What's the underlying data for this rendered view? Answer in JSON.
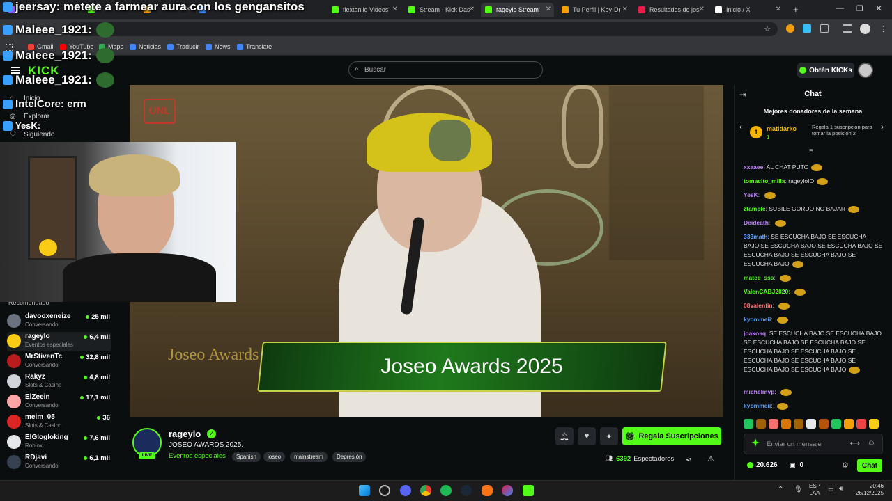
{
  "browser": {
    "tabs": [
      {
        "label": "",
        "color": "#8b5cf6"
      },
      {
        "label": "",
        "color": "#53fc18"
      },
      {
        "label": "",
        "color": "#f59e0b"
      },
      {
        "label": "",
        "color": "#3b82f6"
      },
      {
        "label": "flextanilo Videos",
        "color": "#53fc18"
      },
      {
        "label": "Stream - Kick Das",
        "color": "#53fc18"
      },
      {
        "label": "rageylo Stream",
        "color": "#53fc18",
        "active": true
      },
      {
        "label": "Tu Perfil | Key-Dr",
        "color": "#f59e0b"
      },
      {
        "label": "Resultados de jos",
        "color": "#e11d48"
      },
      {
        "label": "Inicio / X",
        "color": "#ffffff"
      }
    ],
    "bookmarks": [
      {
        "label": "Gmail",
        "color": "#ea4335"
      },
      {
        "label": "YouTube",
        "color": "#ff0000"
      },
      {
        "label": "Maps",
        "color": "#34a853"
      },
      {
        "label": "Noticias",
        "color": "#4285f4"
      },
      {
        "label": "Traducir",
        "color": "#4285f4"
      },
      {
        "label": "News",
        "color": "#4285f4"
      },
      {
        "label": "Translate",
        "color": "#4285f4"
      }
    ]
  },
  "overlay_chat": [
    {
      "text": "jeersay: metete a farmear aura con los gengansitos"
    },
    {
      "text": "Maleee_1921:"
    },
    {
      "text": "Maleee_1921:"
    },
    {
      "text": "Maleee_1921:"
    },
    {
      "text": "IntelCore: erm"
    },
    {
      "text": "YesK:"
    }
  ],
  "header": {
    "logo": "KICK",
    "search_placeholder": "Buscar",
    "obten_label": "Obtén KICKs"
  },
  "sidebar": {
    "nav": [
      {
        "label": "Inicio",
        "icon": "home-icon"
      },
      {
        "label": "Explorar",
        "icon": "compass-icon"
      },
      {
        "label": "Siguiendo",
        "icon": "heart-icon"
      }
    ],
    "section_title": "Recomendado",
    "recommended": [
      {
        "name": "davooxeneize",
        "category": "Conversando",
        "viewers": "25 mil",
        "color": "#6b7280"
      },
      {
        "name": "rageylo",
        "category": "Eventos especiales",
        "viewers": "6,4 mil",
        "color": "#facc15",
        "active": true
      },
      {
        "name": "MrStivenTc",
        "category": "Conversando",
        "viewers": "32,8 mil",
        "color": "#b91c1c"
      },
      {
        "name": "Rakyz",
        "category": "Slots & Casino",
        "viewers": "4,8 mil",
        "color": "#d1d5db"
      },
      {
        "name": "ElZeein",
        "category": "Conversando",
        "viewers": "17,1 mil",
        "color": "#fca5a5"
      },
      {
        "name": "meim_05",
        "category": "Slots & Casino",
        "viewers": "36",
        "color": "#dc2626"
      },
      {
        "name": "ElGlogloking",
        "category": "Roblox",
        "viewers": "7,6 mil",
        "color": "#e5e7eb"
      },
      {
        "name": "RDjavi",
        "category": "Conversando",
        "viewers": "6,1 mil",
        "color": "#374151"
      }
    ]
  },
  "player": {
    "banner_text": "Joseo Awards 2025",
    "logo_text": "UNL",
    "watermark": "Joseo Awards"
  },
  "stream": {
    "channel": "rageylo",
    "live_label": "LIVE",
    "title": "JOSEO AWARDS 2025.",
    "category": "Eventos especiales",
    "tags": [
      "Spanish",
      "joseo",
      "mainstream",
      "Depresión"
    ],
    "subscribe_label": "Regala Suscripciones",
    "viewers_count": "6392",
    "viewers_label": "Espectadores"
  },
  "chat": {
    "title": "Chat",
    "donors_title": "Mejores donadores de la semana",
    "donor_name": "matidarko",
    "donor_count": "1",
    "donor_promo": "Regala 1 suscripción para tomar la posición 2",
    "messages": [
      {
        "user": "xxaaee",
        "color": "#c084fc",
        "text": "AL CHAT PUTO"
      },
      {
        "user": "tomacito_milla",
        "color": "#53fc18",
        "text": "rageyloIO"
      },
      {
        "user": "YesK",
        "color": "#c084fc",
        "text": ""
      },
      {
        "user": "ztample",
        "color": "#53fc18",
        "text": "SUBILE GORDO NO BAJAR"
      },
      {
        "user": "Deideath",
        "color": "#c084fc",
        "text": ""
      },
      {
        "user": "333math",
        "color": "#60a5fa",
        "text": "SE ESCUCHA BAJO SE ESCUCHA BAJO SE ESCUCHA BAJO SE ESCUCHA BAJO SE ESCUCHA BAJO SE ESCUCHA BAJO SE ESCUCHA BAJO"
      },
      {
        "user": "matee_sss",
        "color": "#53fc18",
        "text": ""
      },
      {
        "user": "ValenCABJ2020",
        "color": "#53fc18",
        "text": ""
      },
      {
        "user": "08valentin",
        "color": "#f87171",
        "text": ""
      },
      {
        "user": "kyommeii",
        "color": "#60a5fa",
        "text": ""
      },
      {
        "user": "joakosq",
        "color": "#c084fc",
        "text": "SE ESCUCHA BAJO SE ESCUCHA BAJO SE ESCUCHA BAJO SE ESCUCHA BAJO SE ESCUCHA BAJO SE ESCUCHA BAJO SE ESCUCHA BAJO SE ESCUCHA BAJO SE ESCUCHA BAJO SE ESCUCHA BAJO"
      },
      {
        "user": "michelmvp",
        "color": "#c084fc",
        "text": ""
      },
      {
        "user": "kyommeii",
        "color": "#60a5fa",
        "text": ""
      }
    ],
    "input_placeholder": "Enviar un mensaje",
    "kicks_balance": "20.626",
    "gift_count": "0",
    "send_label": "Chat"
  },
  "taskbar": {
    "lang": "ESP",
    "lang_sub": "LAA",
    "time": "20:46",
    "date": "26/12/2025"
  }
}
